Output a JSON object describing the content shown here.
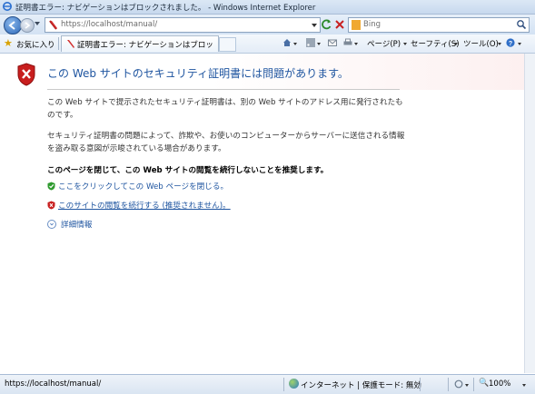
{
  "window": {
    "title": "証明書エラー: ナビゲーションはブロックされました。 - Windows Internet Explorer"
  },
  "address": {
    "url": "https://localhost/manual/"
  },
  "search": {
    "placeholder": "Bing"
  },
  "favorites": {
    "label": "お気に入り"
  },
  "tab": {
    "label": "証明書エラー: ナビゲーションはブロックされ..."
  },
  "commands": {
    "page": "ページ(P)",
    "safety": "セーフティ(S)",
    "tools": "ツール(O)"
  },
  "page": {
    "heading": "この Web サイトのセキュリティ証明書には問題があります。",
    "para1": "この Web サイトで提示されたセキュリティ証明書は、別の Web サイトのアドレス用に発行されたものです。",
    "para2": "セキュリティ証明書の問題によって、詐欺や、お使いのコンピューターからサーバーに送信される情報を盗み取る意図が示唆されている場合があります。",
    "recommend": "このページを閉じて、この Web サイトの閲覧を続行しないことを推奨します。",
    "close_link": "ここをクリックしてこの Web ページを閉じる。",
    "continue_link": "このサイトの閲覧を続行する (推奨されません)。",
    "details": "詳細情報"
  },
  "status": {
    "url": "https://localhost/manual/",
    "zone": "インターネット | 保護モード: 無効",
    "zoom": "100%"
  }
}
